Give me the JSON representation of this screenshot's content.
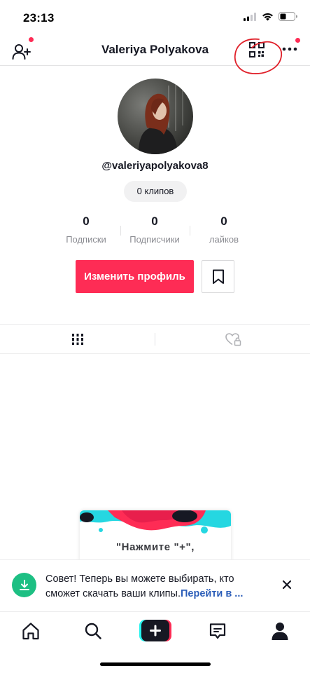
{
  "status_bar": {
    "time": "23:13"
  },
  "header": {
    "title": "Valeriya Polyakova"
  },
  "profile": {
    "username": "@valeriyapolyakova8",
    "clips_badge": "0 клипов",
    "stats": [
      {
        "value": "0",
        "label": "Подписки"
      },
      {
        "value": "0",
        "label": "Подписчики"
      },
      {
        "value": "0",
        "label": "лайков"
      }
    ],
    "edit_label": "Изменить профиль"
  },
  "promo": {
    "text": "\"Нажмите \"+\","
  },
  "tip": {
    "text": "Совет! Теперь вы можете выбирать, кто сможет скачать ваши клипы.",
    "link": "Перейти в ..."
  },
  "colors": {
    "accent": "#fe2c55",
    "tip_icon": "#1dbf83",
    "link": "#2b5db8",
    "annotation": "#e0202a"
  },
  "icons": {
    "header": [
      "add-friend-icon",
      "qr-code-icon",
      "more-icon"
    ],
    "tabs": [
      "grid-icon",
      "liked-private-icon"
    ],
    "nav": [
      "home-icon",
      "search-icon",
      "create-icon",
      "inbox-icon",
      "profile-icon"
    ]
  }
}
